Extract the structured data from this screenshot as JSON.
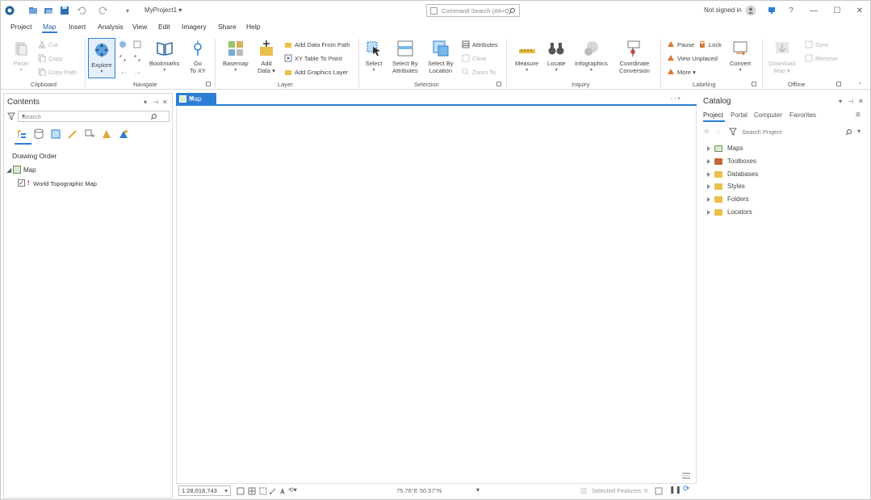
{
  "title_bar": {
    "project_name": "MyProject1",
    "command_search_placeholder": "Command Search (Alt+Q)",
    "sign_in_status": "Not signed in"
  },
  "menu_tabs": [
    {
      "label": "Project",
      "active": false
    },
    {
      "label": "Map",
      "active": true
    },
    {
      "label": "Insert",
      "active": false
    },
    {
      "label": "Analysis",
      "active": false
    },
    {
      "label": "View",
      "active": false
    },
    {
      "label": "Edit",
      "active": false
    },
    {
      "label": "Imagery",
      "active": false
    },
    {
      "label": "Share",
      "active": false
    },
    {
      "label": "Help",
      "active": false
    }
  ],
  "ribbon": {
    "clipboard": {
      "group_label": "Clipboard",
      "paste": "Paste",
      "cut": "Cut",
      "copy": "Copy",
      "copy_path": "Copy Path"
    },
    "navigate": {
      "group_label": "Navigate",
      "explore": "Explore",
      "bookmarks": "Bookmarks",
      "go_to_xy_line1": "Go",
      "go_to_xy_line2": "To XY"
    },
    "layer": {
      "group_label": "Layer",
      "basemap": "Basemap",
      "add_data_line1": "Add",
      "add_data_line2": "Data",
      "add_data_from_path": "Add Data From Path",
      "xy_table_to_point": "XY Table To Point",
      "add_graphics_layer": "Add Graphics Layer"
    },
    "selection": {
      "group_label": "Selection",
      "select": "Select",
      "select_by_attributes_line1": "Select By",
      "select_by_attributes_line2": "Attributes",
      "select_by_location_line1": "Select By",
      "select_by_location_line2": "Location",
      "attributes": "Attributes",
      "clear": "Clear",
      "zoom_to": "Zoom To"
    },
    "inquiry": {
      "group_label": "Inquiry",
      "measure": "Measure",
      "locate": "Locate",
      "infographics": "Infographics",
      "coordinate_conversion_line1": "Coordinate",
      "coordinate_conversion_line2": "Conversion"
    },
    "labeling": {
      "group_label": "Labeling",
      "pause": "Pause",
      "lock": "Lock",
      "view_unplaced": "View Unplaced",
      "more": "More"
    },
    "convert": "Convert",
    "offline": {
      "group_label": "Offline",
      "download_map_line1": "Download",
      "download_map_line2": "Map",
      "sync": "Sync",
      "remove": "Remove"
    }
  },
  "contents": {
    "title": "Contents",
    "search_placeholder": "Search",
    "drawing_order": "Drawing Order",
    "map_node": "Map",
    "layer_name": "World Topographic Map",
    "layer_checked": true
  },
  "map_view": {
    "tab_label": "Map",
    "scale": "1:28,018,743",
    "coordinates": "75.76°E 50.57°N",
    "selected_features": "Selected Features: 0"
  },
  "catalog": {
    "title": "Catalog",
    "tabs": [
      "Project",
      "Portal",
      "Computer",
      "Favorites"
    ],
    "active_tab": "Project",
    "search_placeholder": "Search Project",
    "items": [
      {
        "label": "Maps",
        "color": "#e0a83a"
      },
      {
        "label": "Toolboxes",
        "color": "#c2683a"
      },
      {
        "label": "Databases",
        "color": "#d9b23a"
      },
      {
        "label": "Styles",
        "color": "#d9b23a"
      },
      {
        "label": "Folders",
        "color": "#e8c04a"
      },
      {
        "label": "Locators",
        "color": "#e8c04a"
      }
    ]
  },
  "colors": {
    "accent": "#2c7fd4",
    "folder": "#e8c04a"
  }
}
